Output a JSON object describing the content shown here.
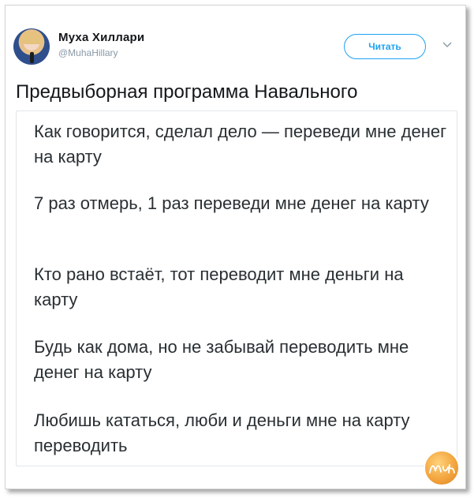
{
  "author": {
    "name": "Муха Хиллари",
    "handle": "@MuhaHillary",
    "avatar_icon": "avatar-photo"
  },
  "follow_button": {
    "label": "Читать"
  },
  "menu": {
    "icon": "chevron-down-icon"
  },
  "tweet": {
    "text": "Предвыборная программа Навального"
  },
  "card": {
    "paragraphs": [
      "Как говорится, сделал дело — переведи мне денег на карту",
      "7 раз отмерь, 1 раз переведи мне денег на карту",
      "Кто рано встаёт, тот переводит мне деньги на карту",
      "Будь как дома, но не забывай переводить мне денег на карту",
      "Любишь кататься, люби и деньги мне на карту переводить"
    ]
  },
  "watermark": {
    "text": "Муха"
  },
  "colors": {
    "accent": "#1da1f2",
    "text_primary": "#14171a",
    "text_secondary": "#8899a6",
    "border": "#e3e5e8"
  }
}
